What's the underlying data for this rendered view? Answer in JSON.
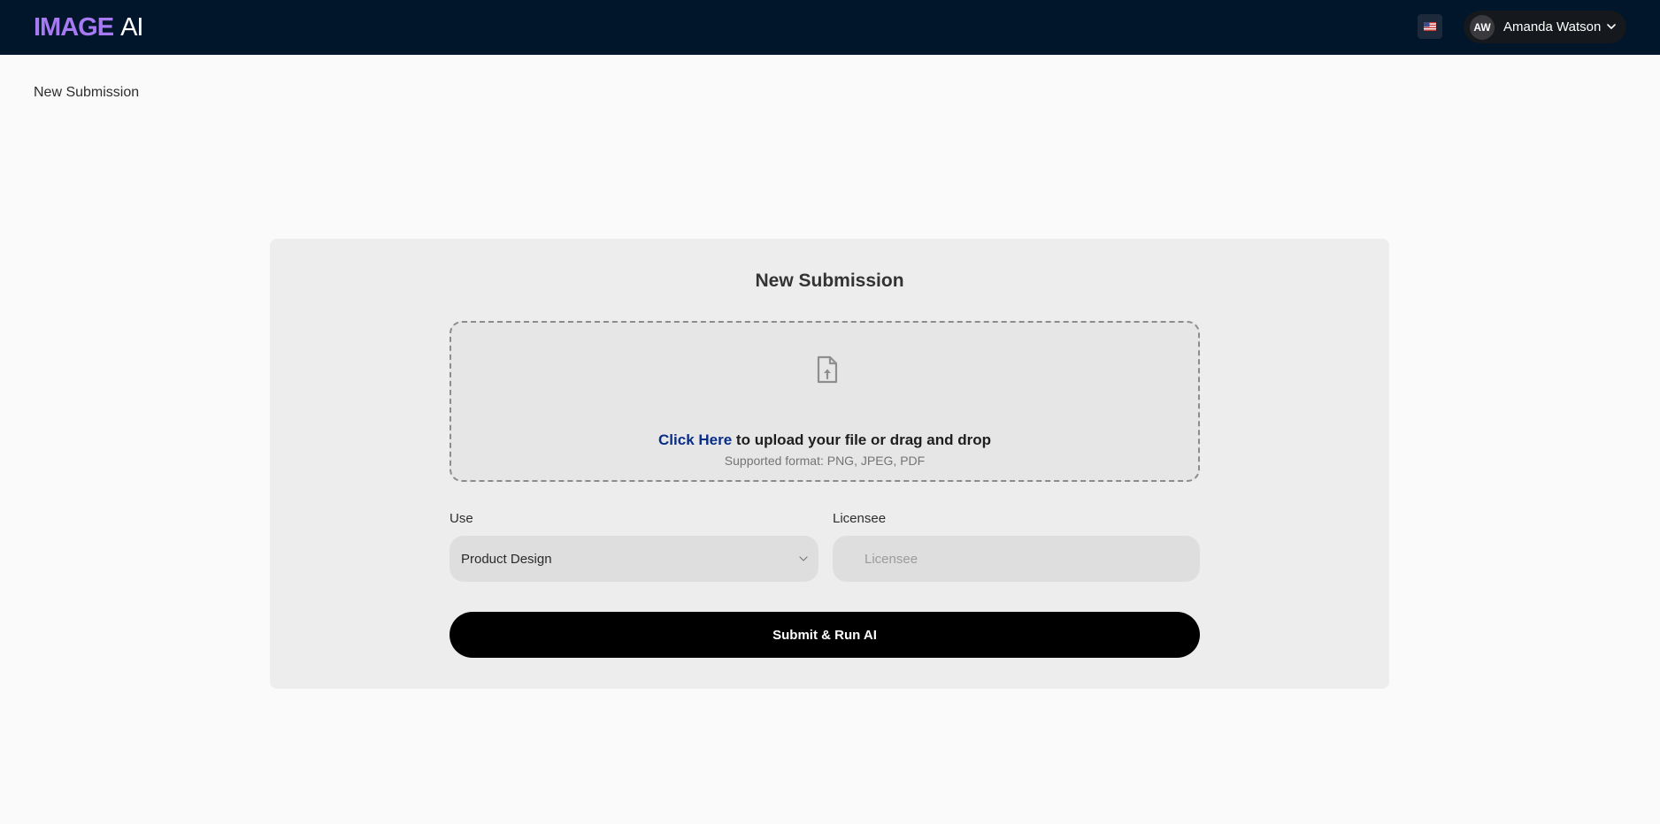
{
  "app": {
    "logo_strong": "IMAGE",
    "logo_light": "AI",
    "brand_color": "#a779f2",
    "topbar_color": "#01152b"
  },
  "header": {
    "language_icon": "us-flag-icon",
    "user": {
      "initials": "AW",
      "name": "Amanda Watson",
      "menu_icon": "chevron-down-icon"
    }
  },
  "page": {
    "title": "New Submission"
  },
  "form": {
    "title": "New Submission",
    "upload": {
      "icon": "file-upload-icon",
      "link_text": "Click Here",
      "instruction": "to upload your file or drag and drop",
      "supported_formats": "Supported format: PNG, JPEG, PDF"
    },
    "use": {
      "label": "Use",
      "selected": "Product Design",
      "icon": "chevron-down-icon"
    },
    "licensee": {
      "label": "Licensee",
      "value": "",
      "placeholder": "Licensee"
    },
    "submit_label": "Submit & Run AI"
  }
}
